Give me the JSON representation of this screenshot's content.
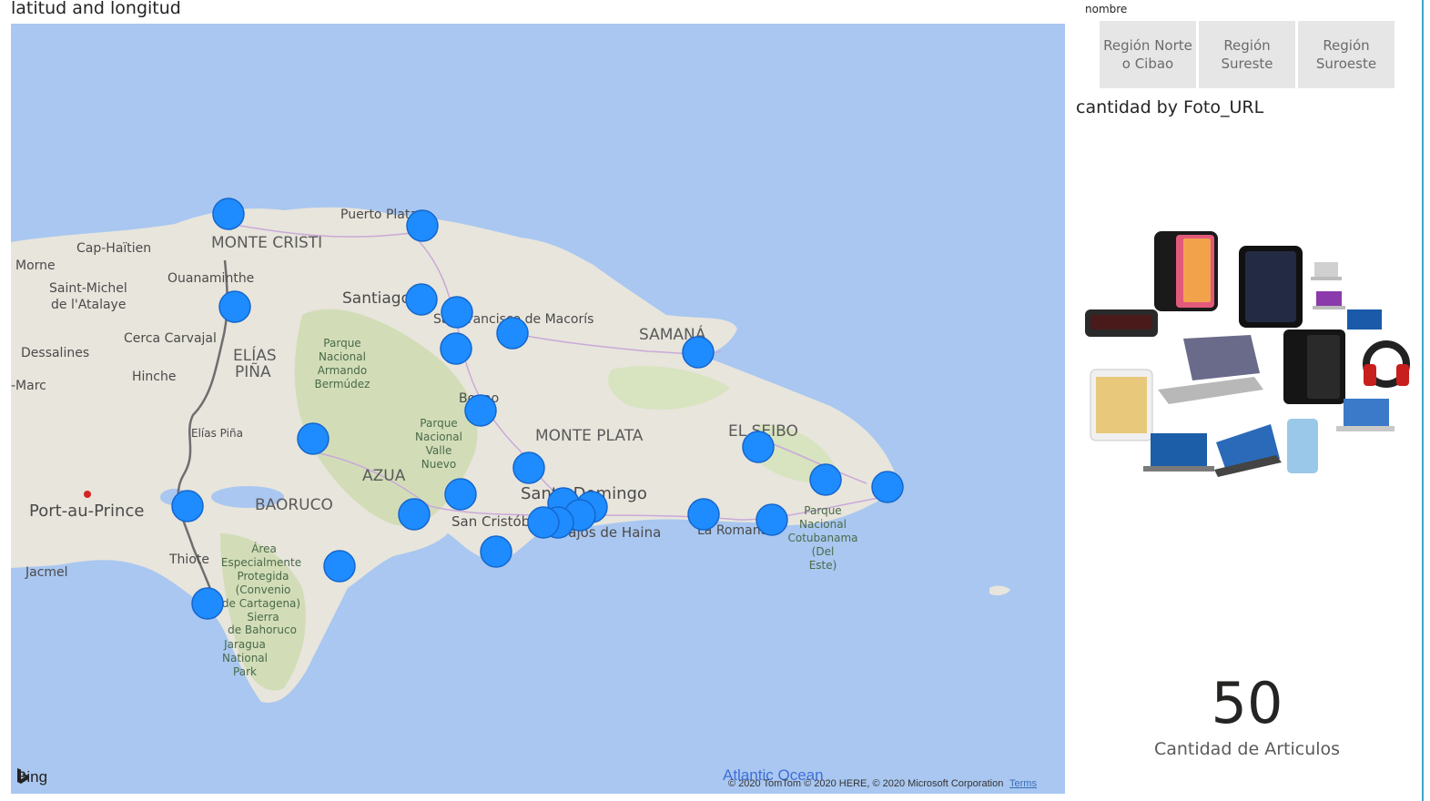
{
  "map_visual": {
    "title": "latitud and longitud",
    "attribution": {
      "provider": "Bing",
      "ocean_label": "Atlantic Ocean",
      "copyright": "© 2020 TomTom © 2020 HERE, © 2020 Microsoft Corporation",
      "terms": "Terms"
    },
    "places": {
      "cap_haitien": "Cap-Haïtien",
      "morne": "Morne",
      "saint_michel_1": "Saint-Michel",
      "saint_michel_2": "de l'Atalaye",
      "dessalines": "Dessalines",
      "marc": "-Marc",
      "hinche": "Hinche",
      "cerca": "Cerca Carvajal",
      "ouanaminthe": "Ouanaminthe",
      "monte_cristi": "MONTE CRISTI",
      "puerto_plata": "Puerto Plata",
      "santiago": "Santiago",
      "sfm": "San Francisco de Macorís",
      "samana": "SAMANÁ",
      "elias_pina_1": "ELÍAS",
      "elias_pina_2": "PIÑA",
      "elias_pina_town": "Elías Piña",
      "bonao": "Bonao",
      "monte_plata": "MONTE PLATA",
      "el_seibo": "EL SEIBO",
      "azua": "AZUA",
      "baoruco": "BAORUCO",
      "santo_domingo": "Santo Domingo",
      "san_cristobal": "San Cristóbal",
      "bajos_haina": "Bajos de Haina",
      "la_romana": "La Romana",
      "port_au_prince": "Port-au-Prince",
      "thiote": "Thiote",
      "jacmel": "Jacmel"
    },
    "parks": {
      "armando_bermudez": [
        "Parque",
        "Nacional",
        "Armando",
        "Bermúdez"
      ],
      "valle_nuevo": [
        "Parque",
        "Nacional",
        "Valle",
        "Nuevo"
      ],
      "cotubanama": [
        "Parque",
        "Nacional",
        "Cotubanama",
        "(Del",
        "Este)"
      ],
      "area_protegida": [
        "Área",
        "Especialmente",
        "Protegida",
        "(Convenio",
        "de Cartagena)",
        "Sierra",
        "de Bahoruco"
      ],
      "jaragua": [
        "Jaragua",
        "National",
        "Park"
      ]
    },
    "marker_color": "#1e8cff",
    "marker_count": 32
  },
  "slicer": {
    "label": "nombre",
    "options": [
      "Región Norte o Cibao",
      "Región Sureste",
      "Región Suroeste"
    ]
  },
  "image_chart": {
    "title": "cantidad by Foto_URL"
  },
  "kpi_card": {
    "value": "50",
    "label": "Cantidad de Articulos"
  }
}
